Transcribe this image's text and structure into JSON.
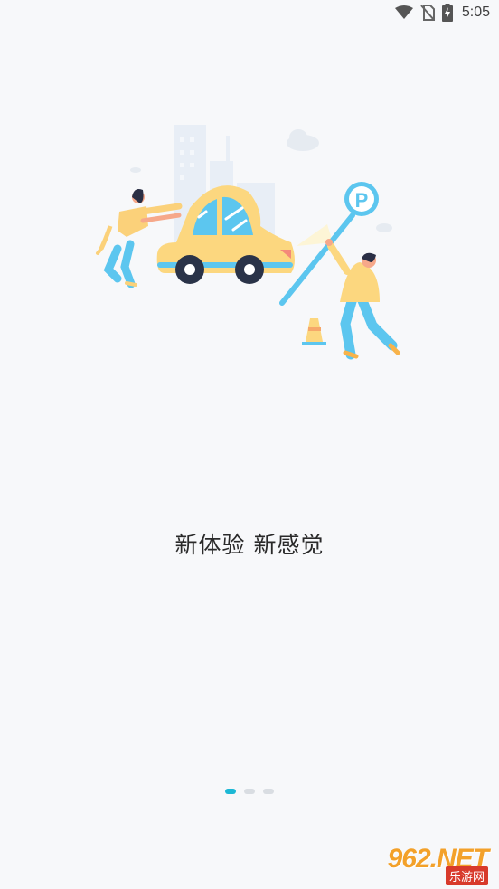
{
  "status_bar": {
    "time": "5:05",
    "icons": [
      "wifi-icon",
      "no-sim-icon",
      "battery-charging-icon"
    ]
  },
  "hero": {
    "parking_sign_letter": "P",
    "icons": [
      "city-buildings-icon",
      "cloud-icon",
      "car-icon",
      "woman-pushing-icon",
      "man-holding-sign-icon",
      "parking-sign-icon",
      "traffic-cone-icon"
    ]
  },
  "onboarding": {
    "slogan": "新体验 新感觉",
    "page_count": 3,
    "current_page": 1
  },
  "watermark": {
    "brand": "962.NET",
    "subtitle": "乐游网"
  },
  "colors": {
    "background": "#f7f8fa",
    "accent": "#1cb8d5",
    "dot_inactive": "#d9dde2",
    "car_yellow": "#fcd77f",
    "sign_blue": "#5cc6ef"
  }
}
